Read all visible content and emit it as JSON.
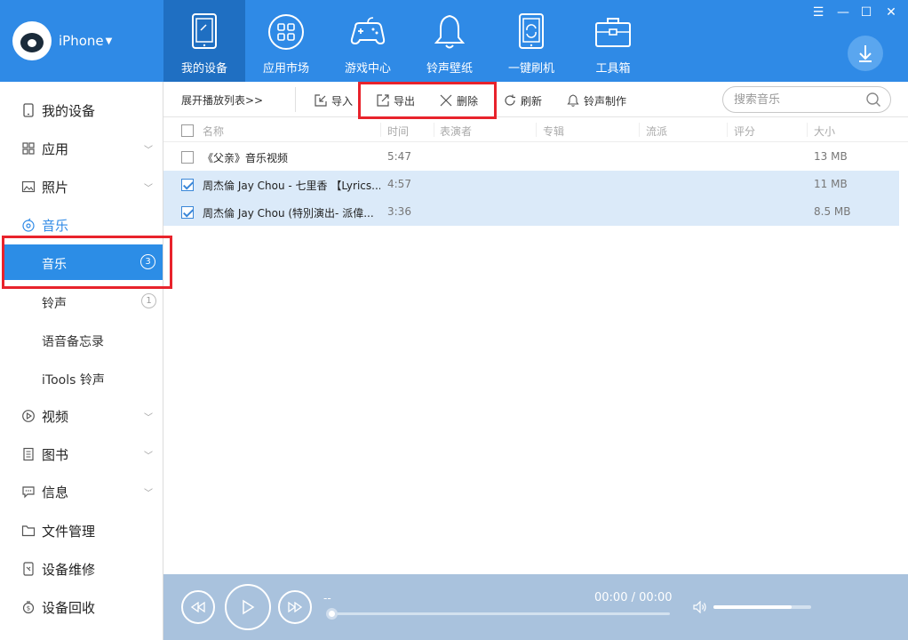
{
  "header": {
    "device_name": "iPhone",
    "tabs": [
      {
        "label": "我的设备",
        "icon": "tablet-icon"
      },
      {
        "label": "应用市场",
        "icon": "apps-grid-icon"
      },
      {
        "label": "游戏中心",
        "icon": "gamepad-icon"
      },
      {
        "label": "铃声壁纸",
        "icon": "bell-icon"
      },
      {
        "label": "一键刷机",
        "icon": "phone-refresh-icon"
      },
      {
        "label": "工具箱",
        "icon": "toolbox-icon"
      }
    ],
    "active_tab": 0,
    "window_controls": {
      "menu": "☰",
      "minimize": "—",
      "maximize": "☐",
      "close": "✕"
    }
  },
  "sidebar": {
    "items": [
      {
        "label": "我的设备",
        "icon": "device-icon"
      },
      {
        "label": "应用",
        "icon": "apps-icon"
      },
      {
        "label": "照片",
        "icon": "photo-icon"
      },
      {
        "label": "音乐",
        "icon": "music-icon"
      },
      {
        "label": "视频",
        "icon": "video-icon"
      },
      {
        "label": "图书",
        "icon": "book-icon"
      },
      {
        "label": "信息",
        "icon": "message-icon"
      },
      {
        "label": "文件管理",
        "icon": "folder-icon"
      },
      {
        "label": "设备维修",
        "icon": "repair-icon"
      },
      {
        "label": "设备回收",
        "icon": "recycle-icon"
      }
    ],
    "music_sub": [
      {
        "label": "音乐",
        "badge": "3"
      },
      {
        "label": "铃声",
        "badge": "1"
      },
      {
        "label": "语音备忘录"
      },
      {
        "label": "iTools 铃声"
      }
    ]
  },
  "toolbar": {
    "expand": "展开播放列表>>",
    "import": "导入",
    "export": "导出",
    "delete": "删除",
    "refresh": "刷新",
    "ringtone": "铃声制作",
    "search_placeholder": "搜索音乐"
  },
  "table": {
    "headers": [
      "名称",
      "时间",
      "表演者",
      "专辑",
      "流派",
      "评分",
      "大小"
    ],
    "rows": [
      {
        "name": "《父亲》音乐视频",
        "time": "5:47",
        "size": "13 MB",
        "checked": false
      },
      {
        "name": "周杰倫 Jay Chou - 七里香 【Lyrics...",
        "time": "4:57",
        "size": "11 MB",
        "checked": true
      },
      {
        "name": "周杰倫 Jay Chou (特別演出- 派偉...",
        "time": "3:36",
        "size": "8.5 MB",
        "checked": true
      }
    ]
  },
  "player": {
    "track": "--",
    "time": "00:00 / 00:00",
    "volume": 0.8,
    "progress": 0
  },
  "colors": {
    "accent": "#2f8ae6",
    "header_bg": "#2f8ae6",
    "active_tab": "#1f6fc2",
    "highlight": "#e8232c",
    "selected_row": "#dbeaf9",
    "player_bg": "#a9c2dd"
  }
}
